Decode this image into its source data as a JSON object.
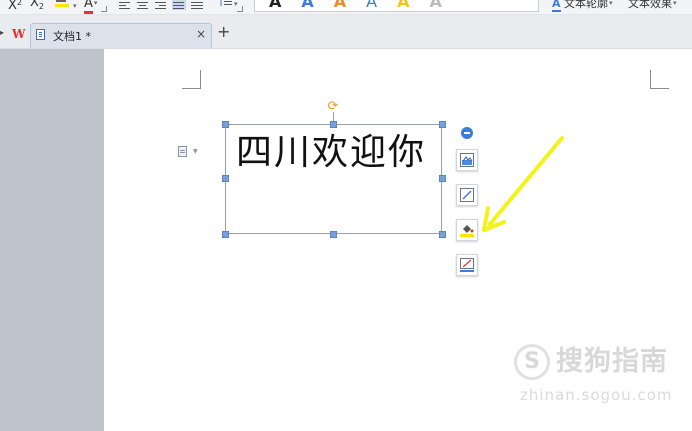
{
  "ribbon": {
    "superscript_label": "X",
    "superscript_mark": "2",
    "subscript_label": "X",
    "subscript_mark": "2",
    "font_color_label": "A",
    "style_samples": [
      "A",
      "A",
      "A",
      "A",
      "A",
      "A"
    ],
    "text_outline_label": "文本轮廓",
    "text_effects_label": "文本效果",
    "caret": "▾"
  },
  "tabbar": {
    "logo": "W",
    "document_tab_label": "文档1 *",
    "close_glyph": "×",
    "add_glyph": "+"
  },
  "document": {
    "textbox_text": "四川欢迎你"
  },
  "floating_toolbar": {
    "items": [
      {
        "icon": "layout-options-icon"
      },
      {
        "icon": "shape-style-icon"
      },
      {
        "icon": "shape-fill-icon"
      },
      {
        "icon": "shape-outline-icon"
      }
    ]
  },
  "watermark": {
    "mark": "S",
    "name": "搜狗指南",
    "url": "zhinan.sogou.com"
  },
  "colors": {
    "accent_blue": "#3f7bd8",
    "handle_blue": "#7a9fd8",
    "rotate_orange": "#f29a1f",
    "arrow_yellow": "#f5f21a",
    "logo_red": "#e8312f"
  }
}
